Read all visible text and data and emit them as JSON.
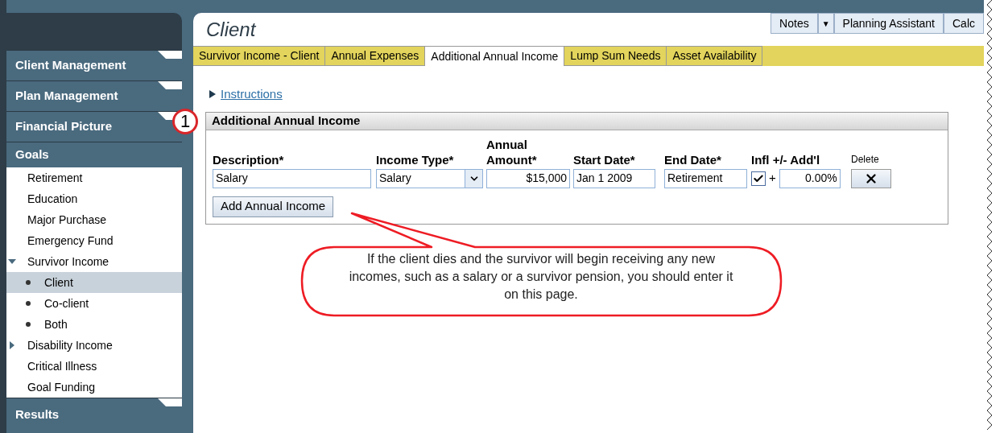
{
  "sidebar": {
    "sections_top": [
      {
        "label": "Client Management"
      },
      {
        "label": "Plan Management"
      },
      {
        "label": "Financial Picture"
      }
    ],
    "goals": {
      "label": "Goals",
      "items": [
        {
          "label": "Retirement",
          "selected": false
        },
        {
          "label": "Education",
          "selected": false
        },
        {
          "label": "Major Purchase",
          "selected": false
        },
        {
          "label": "Emergency Fund",
          "selected": false
        },
        {
          "label": "Survivor Income",
          "selected": false,
          "expanded": true,
          "children": [
            {
              "label": "Client",
              "selected": true
            },
            {
              "label": "Co-client",
              "selected": false
            },
            {
              "label": "Both",
              "selected": false
            }
          ]
        },
        {
          "label": "Disability Income",
          "selected": false,
          "expanded": false
        },
        {
          "label": "Critical Illness",
          "selected": false
        },
        {
          "label": "Goal Funding",
          "selected": false
        }
      ]
    },
    "sections_bottom": [
      {
        "label": "Results"
      }
    ]
  },
  "page": {
    "title": "Client"
  },
  "toolbar": [
    {
      "kind": "button",
      "label": "Notes"
    },
    {
      "kind": "dropdown",
      "label": "▼"
    },
    {
      "kind": "button",
      "label": "Planning Assistant"
    },
    {
      "kind": "button",
      "label": "Calc"
    }
  ],
  "tabs": [
    {
      "label": "Survivor Income - Client",
      "selected": false
    },
    {
      "label": "Annual Expenses",
      "selected": false
    },
    {
      "label": "Additional Annual Income",
      "selected": true
    },
    {
      "label": "Lump Sum Needs",
      "selected": false
    },
    {
      "label": "Asset Availability",
      "selected": false
    }
  ],
  "instructions": {
    "label": "Instructions",
    "expanded": false
  },
  "step_badge": "1",
  "panel": {
    "title": "Additional Annual Income",
    "columns": [
      "Description*",
      "Income Type*",
      "Annual Amount*",
      "Start Date*",
      "End Date*",
      "Infl +/- Add'l",
      "Delete"
    ],
    "rows": [
      {
        "description": "Salary",
        "income_type": "Salary",
        "amount": "$15,000",
        "start_date": "Jan 1 2009",
        "end_date": "Retirement",
        "inflation": true,
        "plus": "+",
        "additional": "0.00%"
      }
    ],
    "add_button": "Add Annual Income"
  },
  "callout": "If the client dies and the survivor will begin receiving any new incomes, such as a salary or a survivor pension, you should enter it on this page."
}
